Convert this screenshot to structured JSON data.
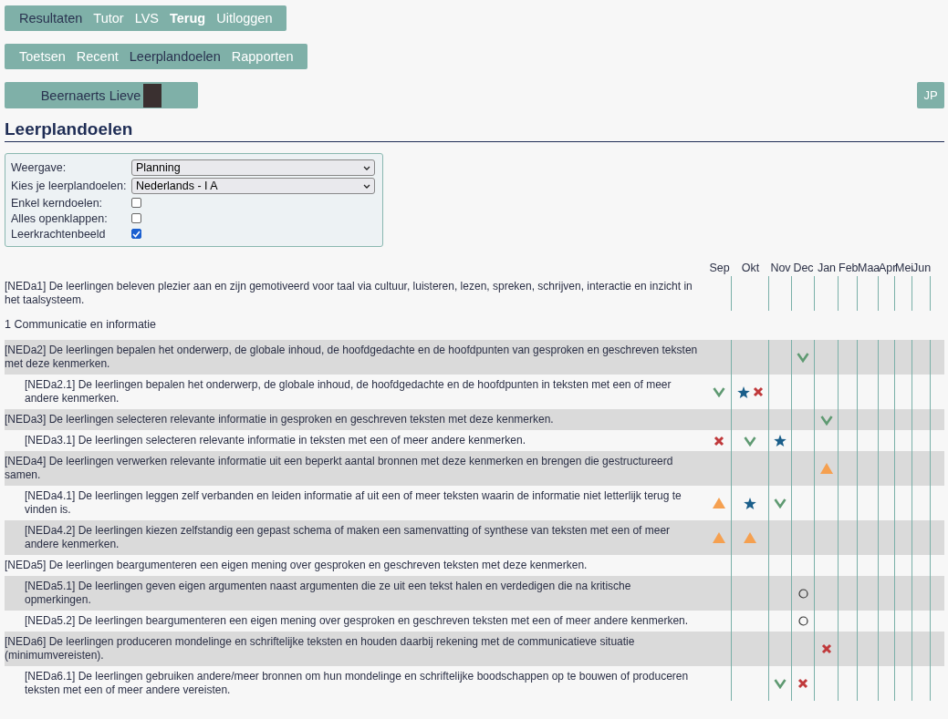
{
  "nav_primary": [
    {
      "label": "Resultaten",
      "selected": true,
      "bold": false
    },
    {
      "label": "Tutor",
      "selected": false,
      "bold": false
    },
    {
      "label": "LVS",
      "selected": false,
      "bold": false
    },
    {
      "label": "Terug",
      "selected": false,
      "bold": true
    },
    {
      "label": "Uitloggen",
      "selected": false,
      "bold": false
    }
  ],
  "nav_secondary": [
    {
      "label": "Toetsen",
      "selected": false
    },
    {
      "label": "Recent",
      "selected": false
    },
    {
      "label": "Leerplandoelen",
      "selected": true
    },
    {
      "label": "Rapporten",
      "selected": false
    }
  ],
  "user": {
    "name": "Beernaerts Lieve",
    "initials": "JP"
  },
  "title": "Leerplandoelen",
  "filters": [
    {
      "kind": "select",
      "label": "Weergave:",
      "value": "Planning"
    },
    {
      "kind": "select",
      "label": "Kies je leerplandoelen:",
      "value": "Nederlands - I A"
    },
    {
      "kind": "checkbox",
      "label": "Enkel kerndoelen:",
      "checked": false
    },
    {
      "kind": "checkbox",
      "label": "Alles openklappen:",
      "checked": false
    },
    {
      "kind": "checkbox",
      "label": "Leerkrachtenbeeld",
      "checked": true
    }
  ],
  "months": [
    "Sep",
    "Okt",
    "Nov",
    "Dec",
    "Jan",
    "Feb",
    "Maa",
    "Apr",
    "Mei",
    "Jun"
  ],
  "intro_goal": {
    "text": "[NEDa1] De leerlingen beleven plezier aan en zijn gemotiveerd voor taal via cultuur, luisteren, lezen, spreken, schrijven, interactie en inzicht in het taalsysteem.",
    "cells": [
      [],
      [],
      [],
      [],
      [],
      [],
      [],
      [],
      [],
      []
    ]
  },
  "sections": [
    {
      "title": "1 Communicatie en informatie",
      "goals": [
        {
          "text": "[NEDa2] De leerlingen bepalen het onderwerp, de globale inhoud, de hoofdgedachte en de hoofdpunten van gesproken en geschreven teksten met deze kenmerken.",
          "cells": [
            [],
            [],
            [],
            [
              {
                "kind": "check"
              }
            ],
            [],
            [],
            [],
            [],
            [],
            []
          ],
          "children": [
            {
              "text": "[NEDa2.1] De leerlingen bepalen het onderwerp, de globale inhoud, de hoofdgedachte en de hoofdpunten in teksten met een of meer andere kenmerken.",
              "cells": [
                [
                  {
                    "kind": "check"
                  }
                ],
                [
                  {
                    "kind": "star"
                  },
                  {
                    "kind": "cross"
                  }
                ],
                [],
                [],
                [],
                [],
                [],
                [],
                [],
                []
              ]
            }
          ]
        },
        {
          "text": "[NEDa3] De leerlingen selecteren relevante informatie in gesproken en geschreven teksten met deze kenmerken.",
          "cells": [
            [],
            [],
            [],
            [],
            [
              {
                "kind": "check"
              }
            ],
            [],
            [],
            [],
            [],
            []
          ],
          "children": [
            {
              "text": "[NEDa3.1] De leerlingen selecteren relevante informatie in teksten met een of meer andere kenmerken.",
              "cells": [
                [
                  {
                    "kind": "cross"
                  }
                ],
                [
                  {
                    "kind": "check"
                  }
                ],
                [
                  {
                    "kind": "star"
                  }
                ],
                [],
                [],
                [],
                [],
                [],
                [],
                []
              ]
            }
          ]
        },
        {
          "text": "[NEDa4] De leerlingen verwerken relevante informatie uit een beperkt aantal bronnen met deze kenmerken en brengen die gestructureerd samen.",
          "cells": [
            [],
            [],
            [],
            [],
            [
              {
                "kind": "triangle"
              }
            ],
            [],
            [],
            [],
            [],
            []
          ],
          "children": [
            {
              "text": "[NEDa4.1] De leerlingen leggen zelf verbanden en leiden informatie af uit een of meer teksten waarin de informatie niet letterlijk terug te vinden is.",
              "cells": [
                [
                  {
                    "kind": "triangle"
                  }
                ],
                [
                  {
                    "kind": "star"
                  }
                ],
                [
                  {
                    "kind": "check"
                  }
                ],
                [],
                [],
                [],
                [],
                [],
                [],
                []
              ]
            },
            {
              "text": "[NEDa4.2] De leerlingen kiezen zelfstandig een gepast schema of maken een samenvatting of synthese van teksten met een of meer andere kenmerken.",
              "cells": [
                [
                  {
                    "kind": "triangle"
                  }
                ],
                [
                  {
                    "kind": "triangle"
                  }
                ],
                [],
                [],
                [],
                [],
                [],
                [],
                [],
                []
              ]
            }
          ]
        },
        {
          "text": "[NEDa5] De leerlingen beargumenteren een eigen mening over gesproken en geschreven teksten met deze kenmerken.",
          "cells": [
            [],
            [],
            [],
            [],
            [],
            [],
            [],
            [],
            [],
            []
          ],
          "children": [
            {
              "text": "[NEDa5.1] De leerlingen geven eigen argumenten naast argumenten die ze uit een tekst halen en verdedigen die na kritische opmerkingen.",
              "cells": [
                [],
                [],
                [],
                [
                  {
                    "kind": "circle"
                  }
                ],
                [],
                [],
                [],
                [],
                [],
                []
              ]
            },
            {
              "text": "[NEDa5.2] De leerlingen beargumenteren een eigen mening over gesproken en geschreven teksten met een of meer andere kenmerken.",
              "cells": [
                [],
                [],
                [],
                [
                  {
                    "kind": "circle"
                  }
                ],
                [],
                [],
                [],
                [],
                [],
                []
              ]
            }
          ]
        },
        {
          "text": "[NEDa6] De leerlingen produceren mondelinge en schriftelijke teksten en houden daarbij rekening met de communicatieve situatie (minimumvereisten).",
          "cells": [
            [],
            [],
            [],
            [],
            [
              {
                "kind": "cross"
              }
            ],
            [],
            [],
            [],
            [],
            []
          ],
          "children": [
            {
              "text": "[NEDa6.1] De leerlingen gebruiken andere/meer bronnen om hun mondelinge en schriftelijke boodschappen op te bouwen of produceren teksten met een of meer andere vereisten.",
              "cells": [
                [],
                [],
                [
                  {
                    "kind": "check"
                  }
                ],
                [
                  {
                    "kind": "cross"
                  }
                ],
                [],
                [],
                [],
                [],
                [],
                []
              ]
            }
          ]
        }
      ]
    }
  ]
}
